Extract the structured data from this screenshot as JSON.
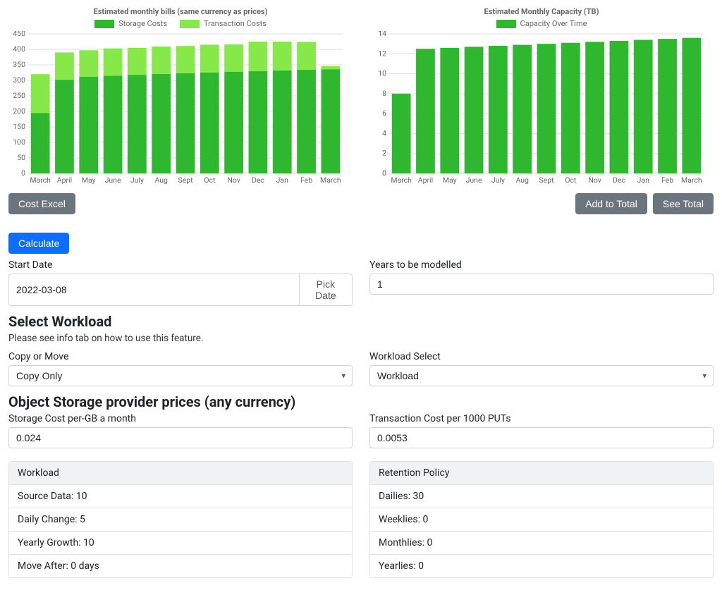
{
  "colors": {
    "storage": "#2fb82f",
    "transaction": "#87e84a",
    "capacity": "#2fb82f"
  },
  "chart_data": [
    {
      "type": "bar",
      "title": "Estimated monthly bills (same currency as prices)",
      "categories": [
        "March",
        "April",
        "May",
        "June",
        "July",
        "Aug",
        "Sept",
        "Oct",
        "Nov",
        "Dec",
        "Jan",
        "Feb",
        "March"
      ],
      "stacked": true,
      "series": [
        {
          "name": "Storage Costs",
          "values": [
            195,
            302,
            312,
            315,
            318,
            321,
            323,
            325,
            328,
            330,
            332,
            334,
            336
          ]
        },
        {
          "name": "Transaction Costs",
          "values": [
            125,
            88,
            85,
            88,
            87,
            88,
            88,
            90,
            88,
            95,
            93,
            90,
            10
          ]
        }
      ],
      "ylim": [
        0,
        450
      ],
      "yticks": [
        0,
        50,
        100,
        150,
        200,
        250,
        300,
        350,
        400,
        450
      ]
    },
    {
      "type": "bar",
      "title": "Estimated Monthly Capacity (TB)",
      "categories": [
        "March",
        "April",
        "May",
        "June",
        "July",
        "Aug",
        "Sept",
        "Oct",
        "Nov",
        "Dec",
        "Jan",
        "Feb",
        "March"
      ],
      "series": [
        {
          "name": "Capacity Over Time",
          "values": [
            8.0,
            12.5,
            12.6,
            12.7,
            12.8,
            12.9,
            13.0,
            13.1,
            13.2,
            13.3,
            13.4,
            13.5,
            13.6
          ]
        }
      ],
      "ylim": [
        0,
        14
      ],
      "yticks": [
        0,
        2,
        4,
        6,
        8,
        10,
        12,
        14
      ]
    }
  ],
  "buttons": {
    "cost_excel": "Cost Excel",
    "add_to_total": "Add to Total",
    "see_total": "See Total",
    "calculate": "Calculate",
    "pick_date": "Pick Date"
  },
  "form": {
    "start_date": {
      "label": "Start Date",
      "value": "2022-03-08"
    },
    "years": {
      "label": "Years to be modelled",
      "value": "1"
    },
    "select_workload_heading": "Select Workload",
    "select_workload_hint": "Please see info tab on how to use this feature.",
    "copy_move": {
      "label": "Copy or Move",
      "value": "Copy Only"
    },
    "workload_select": {
      "label": "Workload Select",
      "value": "Workload"
    },
    "provider_heading": "Object Storage provider prices (any currency)",
    "storage_cost": {
      "label": "Storage Cost per-GB a month",
      "value": "0.024"
    },
    "txn_cost": {
      "label": "Transaction Cost per 1000 PUTs",
      "value": "0.0053"
    }
  },
  "summaries": {
    "workload": {
      "header": "Workload",
      "items": [
        "Source Data: 10",
        "Daily Change: 5",
        "Yearly Growth: 10",
        "Move After: 0 days"
      ]
    },
    "retention": {
      "header": "Retention Policy",
      "items": [
        "Dailies: 30",
        "Weeklies: 0",
        "Monthlies: 0",
        "Yearlies: 0"
      ]
    }
  }
}
